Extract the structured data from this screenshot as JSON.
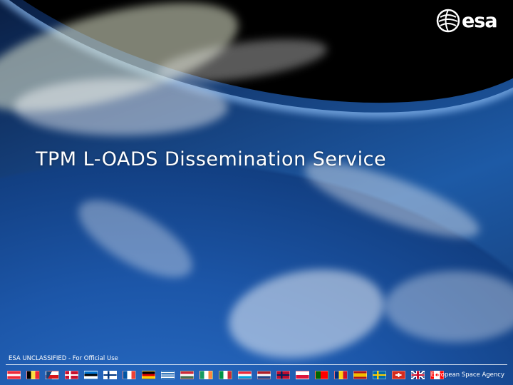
{
  "logo": {
    "text": "esa",
    "icon": "esa-globe-icon"
  },
  "slide": {
    "title": "TPM L-OADS Dissemination Service"
  },
  "footer": {
    "classification": "ESA UNCLASSIFIED - For Official Use",
    "agency": "European Space Agency",
    "flags": [
      {
        "name": "austria",
        "colors": [
          "#ed2939",
          "#ffffff",
          "#ed2939"
        ],
        "layout": "h"
      },
      {
        "name": "belgium",
        "colors": [
          "#000000",
          "#fae042",
          "#ed2939"
        ],
        "layout": "v"
      },
      {
        "name": "czech-republic",
        "colors": [
          "#ffffff",
          "#d7141a",
          "#11457e"
        ],
        "layout": "cz"
      },
      {
        "name": "denmark",
        "colors": [
          "#c8102e",
          "#ffffff"
        ],
        "layout": "nordic"
      },
      {
        "name": "estonia",
        "colors": [
          "#0072ce",
          "#000000",
          "#ffffff"
        ],
        "layout": "h"
      },
      {
        "name": "finland",
        "colors": [
          "#ffffff",
          "#003580"
        ],
        "layout": "nordic"
      },
      {
        "name": "france",
        "colors": [
          "#0055a4",
          "#ffffff",
          "#ef4135"
        ],
        "layout": "v"
      },
      {
        "name": "germany",
        "colors": [
          "#000000",
          "#dd0000",
          "#ffce00"
        ],
        "layout": "h"
      },
      {
        "name": "greece",
        "colors": [
          "#0d5eaf",
          "#ffffff",
          "#0d5eaf"
        ],
        "layout": "stripes"
      },
      {
        "name": "hungary",
        "colors": [
          "#ce2939",
          "#ffffff",
          "#477050"
        ],
        "layout": "h"
      },
      {
        "name": "ireland",
        "colors": [
          "#169b62",
          "#ffffff",
          "#ff883e"
        ],
        "layout": "v"
      },
      {
        "name": "italy",
        "colors": [
          "#009246",
          "#ffffff",
          "#ce2b37"
        ],
        "layout": "v"
      },
      {
        "name": "luxembourg",
        "colors": [
          "#ed2939",
          "#ffffff",
          "#00a1de"
        ],
        "layout": "h"
      },
      {
        "name": "netherlands",
        "colors": [
          "#ae1c28",
          "#ffffff",
          "#21468b"
        ],
        "layout": "h"
      },
      {
        "name": "norway",
        "colors": [
          "#ba0c2f",
          "#00205b"
        ],
        "layout": "nordic"
      },
      {
        "name": "poland",
        "colors": [
          "#ffffff",
          "#dc143c"
        ],
        "layout": "h2"
      },
      {
        "name": "portugal",
        "colors": [
          "#006600",
          "#ff0000"
        ],
        "layout": "pt"
      },
      {
        "name": "romania",
        "colors": [
          "#002b7f",
          "#fcd116",
          "#ce1126"
        ],
        "layout": "v"
      },
      {
        "name": "spain",
        "colors": [
          "#aa151b",
          "#f1bf00",
          "#aa151b"
        ],
        "layout": "es"
      },
      {
        "name": "sweden",
        "colors": [
          "#006aa7",
          "#fecc00"
        ],
        "layout": "nordic"
      },
      {
        "name": "switzerland",
        "colors": [
          "#d52b1e",
          "#ffffff"
        ],
        "layout": "ch"
      },
      {
        "name": "united-kingdom",
        "colors": [
          "#012169",
          "#ffffff",
          "#c8102e"
        ],
        "layout": "uk"
      },
      {
        "name": "canada",
        "colors": [
          "#ff0000",
          "#ffffff",
          "#ff0000"
        ],
        "layout": "ca"
      }
    ]
  }
}
